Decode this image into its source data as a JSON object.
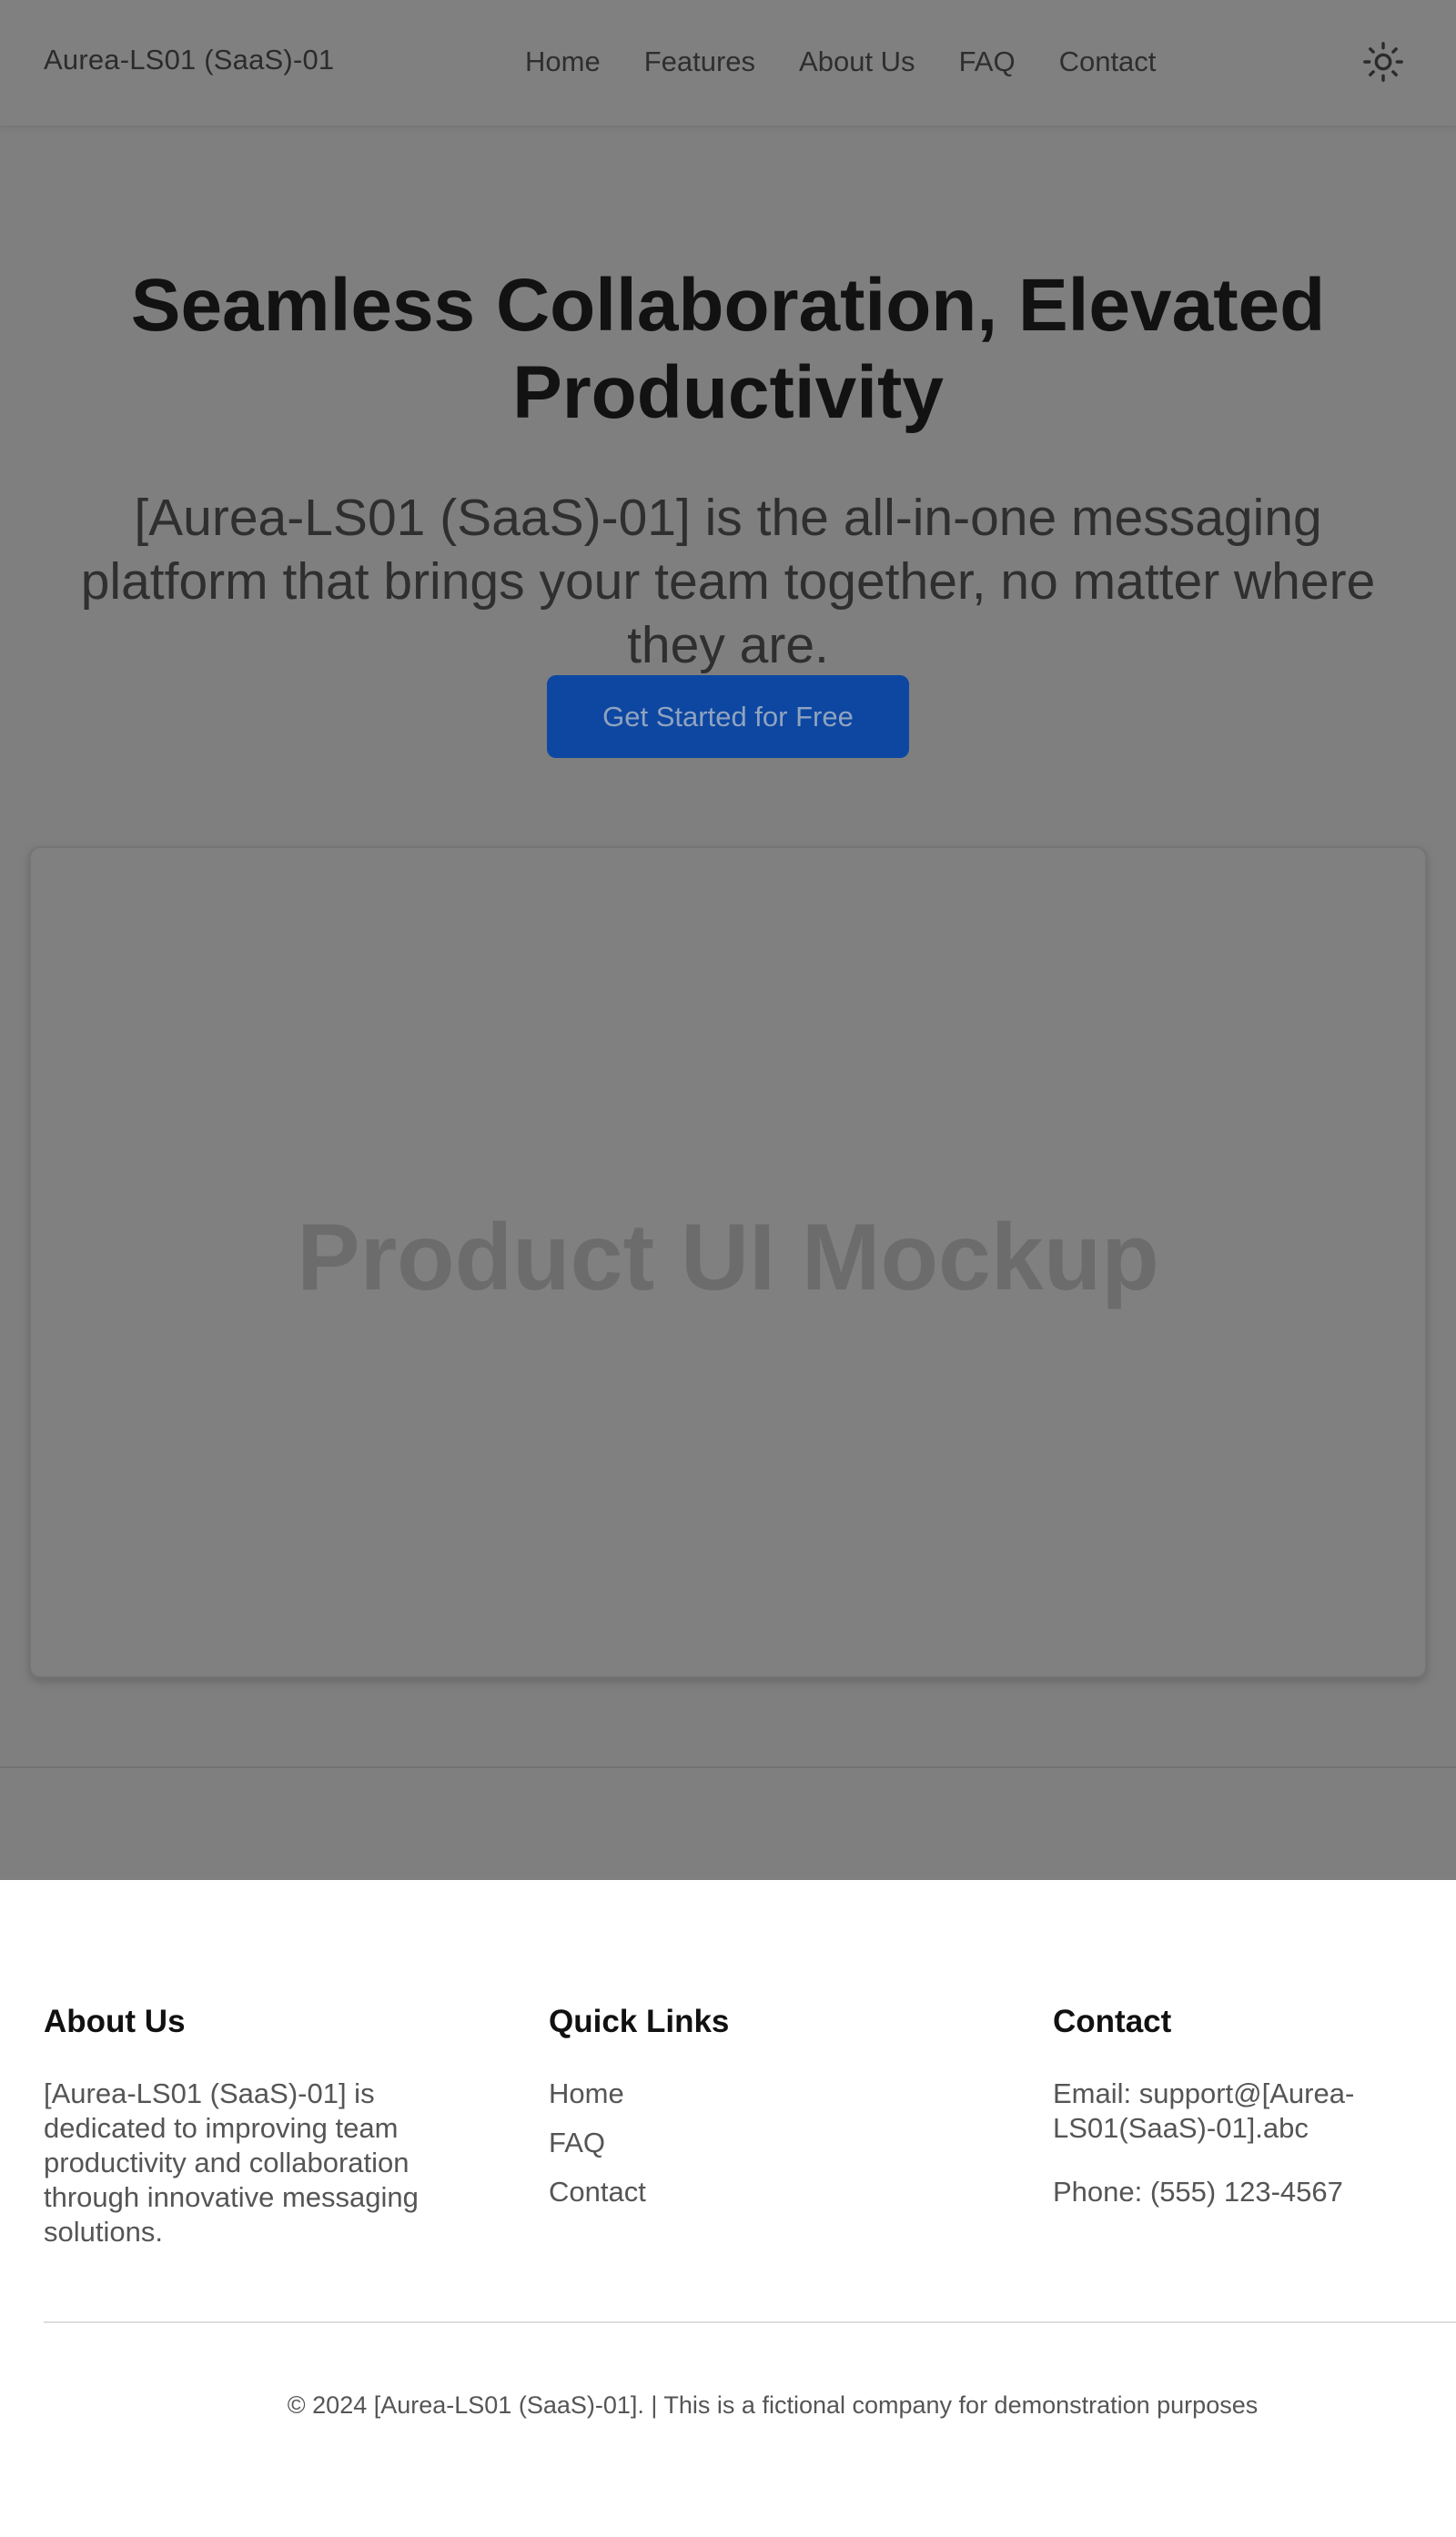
{
  "navbar": {
    "brand": "Aurea-LS01 (SaaS)-01",
    "links": [
      "Home",
      "Features",
      "About Us",
      "FAQ",
      "Contact"
    ],
    "theme_icon": "sun-icon"
  },
  "hero": {
    "title": "Seamless Collaboration, Elevated Productivity",
    "subtitle": "[Aurea-LS01 (SaaS)-01] is the all-in-one messaging platform that brings your team together, no matter where they are.",
    "cta_label": "Get Started for Free",
    "mockup_label": "Product UI Mockup"
  },
  "footer": {
    "about": {
      "heading": "About Us",
      "text": "[Aurea-LS01 (SaaS)-01] is dedicated to improving team productivity and collaboration through innovative messaging solutions."
    },
    "quick_links": {
      "heading": "Quick Links",
      "links": [
        "Home",
        "FAQ",
        "Contact"
      ]
    },
    "contact": {
      "heading": "Contact",
      "email": "Email: support@[Aurea-LS01(SaaS)-01].abc",
      "phone": "Phone: (555) 123-4567"
    },
    "copyright": "© 2024 [Aurea-LS01 (SaaS)-01]. | This is a fictional company for demonstration purposes"
  },
  "colors": {
    "overlay_gray": "#7f7f7f",
    "cta_blue": "#0d47a1",
    "footer_bg": "#ffffff"
  }
}
